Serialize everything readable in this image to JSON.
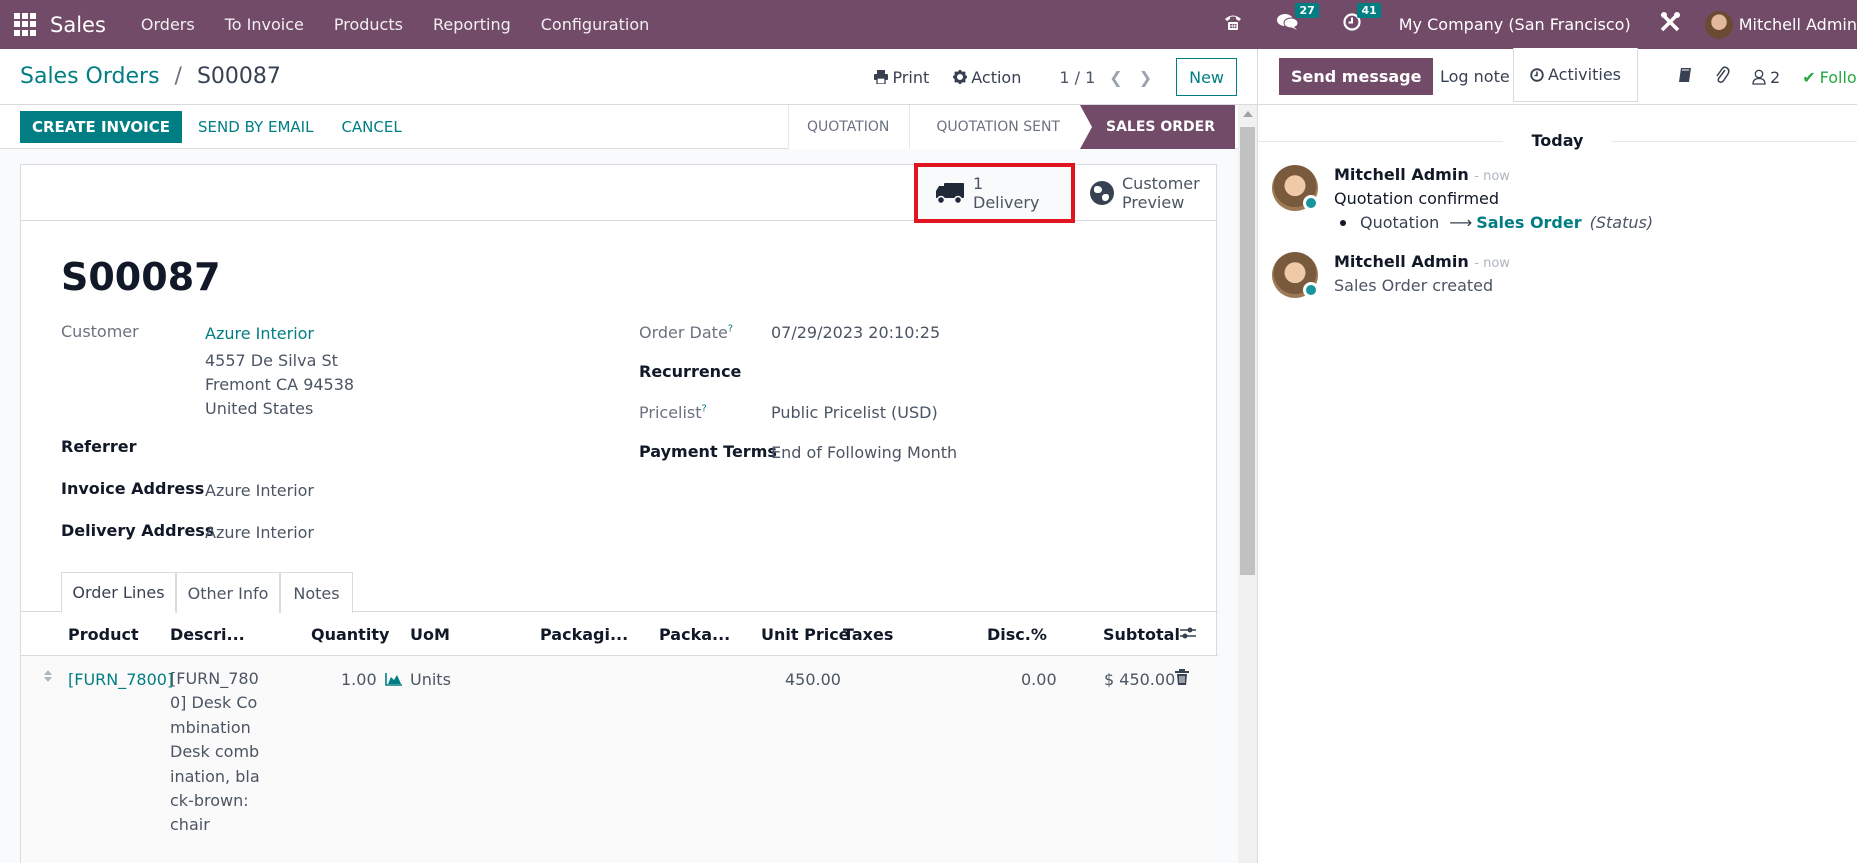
{
  "navbar": {
    "app_name": "Sales",
    "menu": [
      "Orders",
      "To Invoice",
      "Products",
      "Reporting",
      "Configuration"
    ],
    "icons": {
      "phone": "phone-icon",
      "messages": "chat-icon",
      "activities": "clock-icon",
      "debug": "tools-icon"
    },
    "messages_count": "27",
    "activities_count": "41",
    "company": "My Company (San Francisco)",
    "user": "Mitchell Admin"
  },
  "control_panel": {
    "breadcrumb_parent": "Sales Orders",
    "breadcrumb_separator": "/",
    "breadcrumb_current": "S00087",
    "print_label": "Print",
    "action_label": "Action",
    "pager": "1 / 1",
    "new_label": "New"
  },
  "statusbar": {
    "buttons": [
      "CREATE INVOICE",
      "SEND BY EMAIL",
      "CANCEL"
    ],
    "stages": [
      "QUOTATION",
      "QUOTATION SENT",
      "SALES ORDER"
    ],
    "active_stage": "SALES ORDER"
  },
  "smart_buttons": {
    "delivery_count": "1",
    "delivery_label": "Delivery",
    "preview_line1": "Customer",
    "preview_line2": "Preview"
  },
  "form": {
    "title": "S00087",
    "customer_label": "Customer",
    "customer_name": "Azure Interior",
    "customer_address": [
      "4557 De Silva St",
      "Fremont CA 94538",
      "United States"
    ],
    "referrer_label": "Referrer",
    "invoice_address_label": "Invoice Address",
    "invoice_address": "Azure Interior",
    "delivery_address_label": "Delivery Address",
    "delivery_address": "Azure Interior",
    "order_date_label": "Order Date",
    "order_date": "07/29/2023 20:10:25",
    "recurrence_label": "Recurrence",
    "pricelist_label": "Pricelist",
    "pricelist": "Public Pricelist (USD)",
    "payment_terms_label": "Payment Terms",
    "payment_terms": "End of Following Month",
    "help_mark": "?"
  },
  "tabs": [
    "Order Lines",
    "Other Info",
    "Notes"
  ],
  "order_lines": {
    "columns": [
      "Product",
      "Descri...",
      "Quantity",
      "UoM",
      "Packagi...",
      "Packa...",
      "Unit Price",
      "Taxes",
      "Disc.%",
      "Subtotal"
    ],
    "rows": [
      {
        "product": "[FURN_7800]",
        "description": "[FURN_7800] Desk Combination Desk combination, black-brown: chair",
        "quantity": "1.00",
        "uom": "Units",
        "packaging": "",
        "packaging_qty": "",
        "unit_price": "450.00",
        "taxes": "",
        "discount": "0.00",
        "subtotal": "$ 450.00"
      }
    ]
  },
  "chatter": {
    "send_message": "Send message",
    "log_note": "Log note",
    "activities": "Activities",
    "followers_count": "2",
    "follow_label": "Following",
    "day_separator": "Today",
    "messages": [
      {
        "author": "Mitchell Admin",
        "time": "- now",
        "body": "Quotation confirmed",
        "change": {
          "old": "Quotation",
          "new": "Sales Order",
          "field": "(Status)"
        }
      },
      {
        "author": "Mitchell Admin",
        "time": "- now",
        "body": "Sales Order created"
      }
    ]
  }
}
